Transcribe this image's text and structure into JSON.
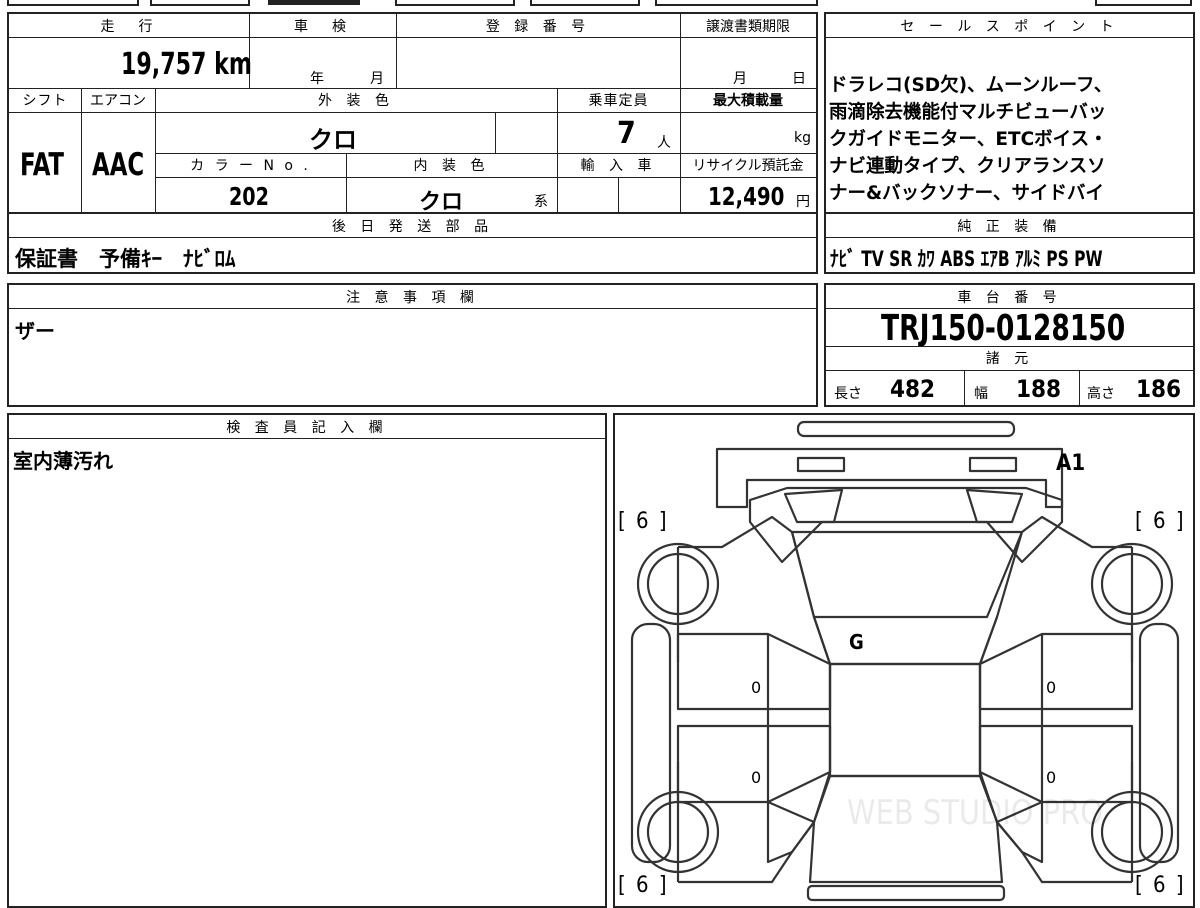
{
  "left_top": {
    "mileage_header": "走　行",
    "mileage_value": "19,757 km",
    "shaken_header": "車　検",
    "shaken_year": "年",
    "shaken_month": "月",
    "registration_header": "登 録 番 号",
    "transfer_deadline_header": "譲渡書類期限",
    "transfer_month": "月",
    "transfer_day": "日",
    "shift_header": "シフト",
    "aircon_header": "エアコン",
    "exterior_color_header": "外 装 色",
    "capacity_header": "乗車定員",
    "max_load_header": "最大積載量",
    "shift_value": "FAT",
    "aircon_value": "AAC",
    "exterior_color_value": "クロ",
    "capacity_value": "7",
    "capacity_unit": "人",
    "max_load_unit": "kg",
    "color_no_header": "カ ラ ー N o .",
    "interior_color_header": "内 装 色",
    "import_header": "輸 入 車",
    "recycle_header": "リサイクル預託金",
    "color_no_value": "202",
    "interior_color_value": "クロ",
    "interior_color_suffix": "系",
    "recycle_value": "12,490",
    "recycle_unit": "円",
    "later_parts_header": "後 日 発 送 部 品",
    "later_parts_value": "保証書　予備ｷｰ　ﾅﾋﾞﾛﾑ"
  },
  "sales_point": {
    "header": "セ ー ル ス ポ イ ン ト",
    "lines": [
      "ドラレコ(SD欠)、ムーンルーフ、",
      "雨滴除去機能付マルチビューバッ",
      "クガイドモニター、ETCボイス・",
      "ナビ連動タイプ、クリアランスソ",
      "ナー&バックソナー、サイドバイ"
    ]
  },
  "genuine_equipment": {
    "header": "純 正 装 備",
    "value": "ﾅﾋﾞ TV SR ｶﾜ ABS ｴｱB ｱﾙﾐ PS PW"
  },
  "notes": {
    "header": "注 意 事 項 欄",
    "value": "ザー"
  },
  "chassis": {
    "header": "車 台 番 号",
    "value": "TRJ150-0128150"
  },
  "specs": {
    "header": "諸 元",
    "length_label": "長さ",
    "length_value": "482",
    "width_label": "幅",
    "width_value": "188",
    "height_label": "高さ",
    "height_value": "186"
  },
  "inspector": {
    "header": "検 査 員 記 入 欄",
    "value": "室内薄汚れ"
  },
  "diagram": {
    "tire_fl": "[ 6 ]",
    "tire_fr": "[ 6 ]",
    "tire_rl": "[ 6 ]",
    "tire_rr": "[ 6 ]",
    "front_mark": "A1",
    "windshield_mark": "G",
    "door_mark_fl": "0",
    "door_mark_rl": "0",
    "door_mark_fr": "0",
    "door_mark_rr": "0",
    "watermark": "WEB STUDIO PRO"
  }
}
